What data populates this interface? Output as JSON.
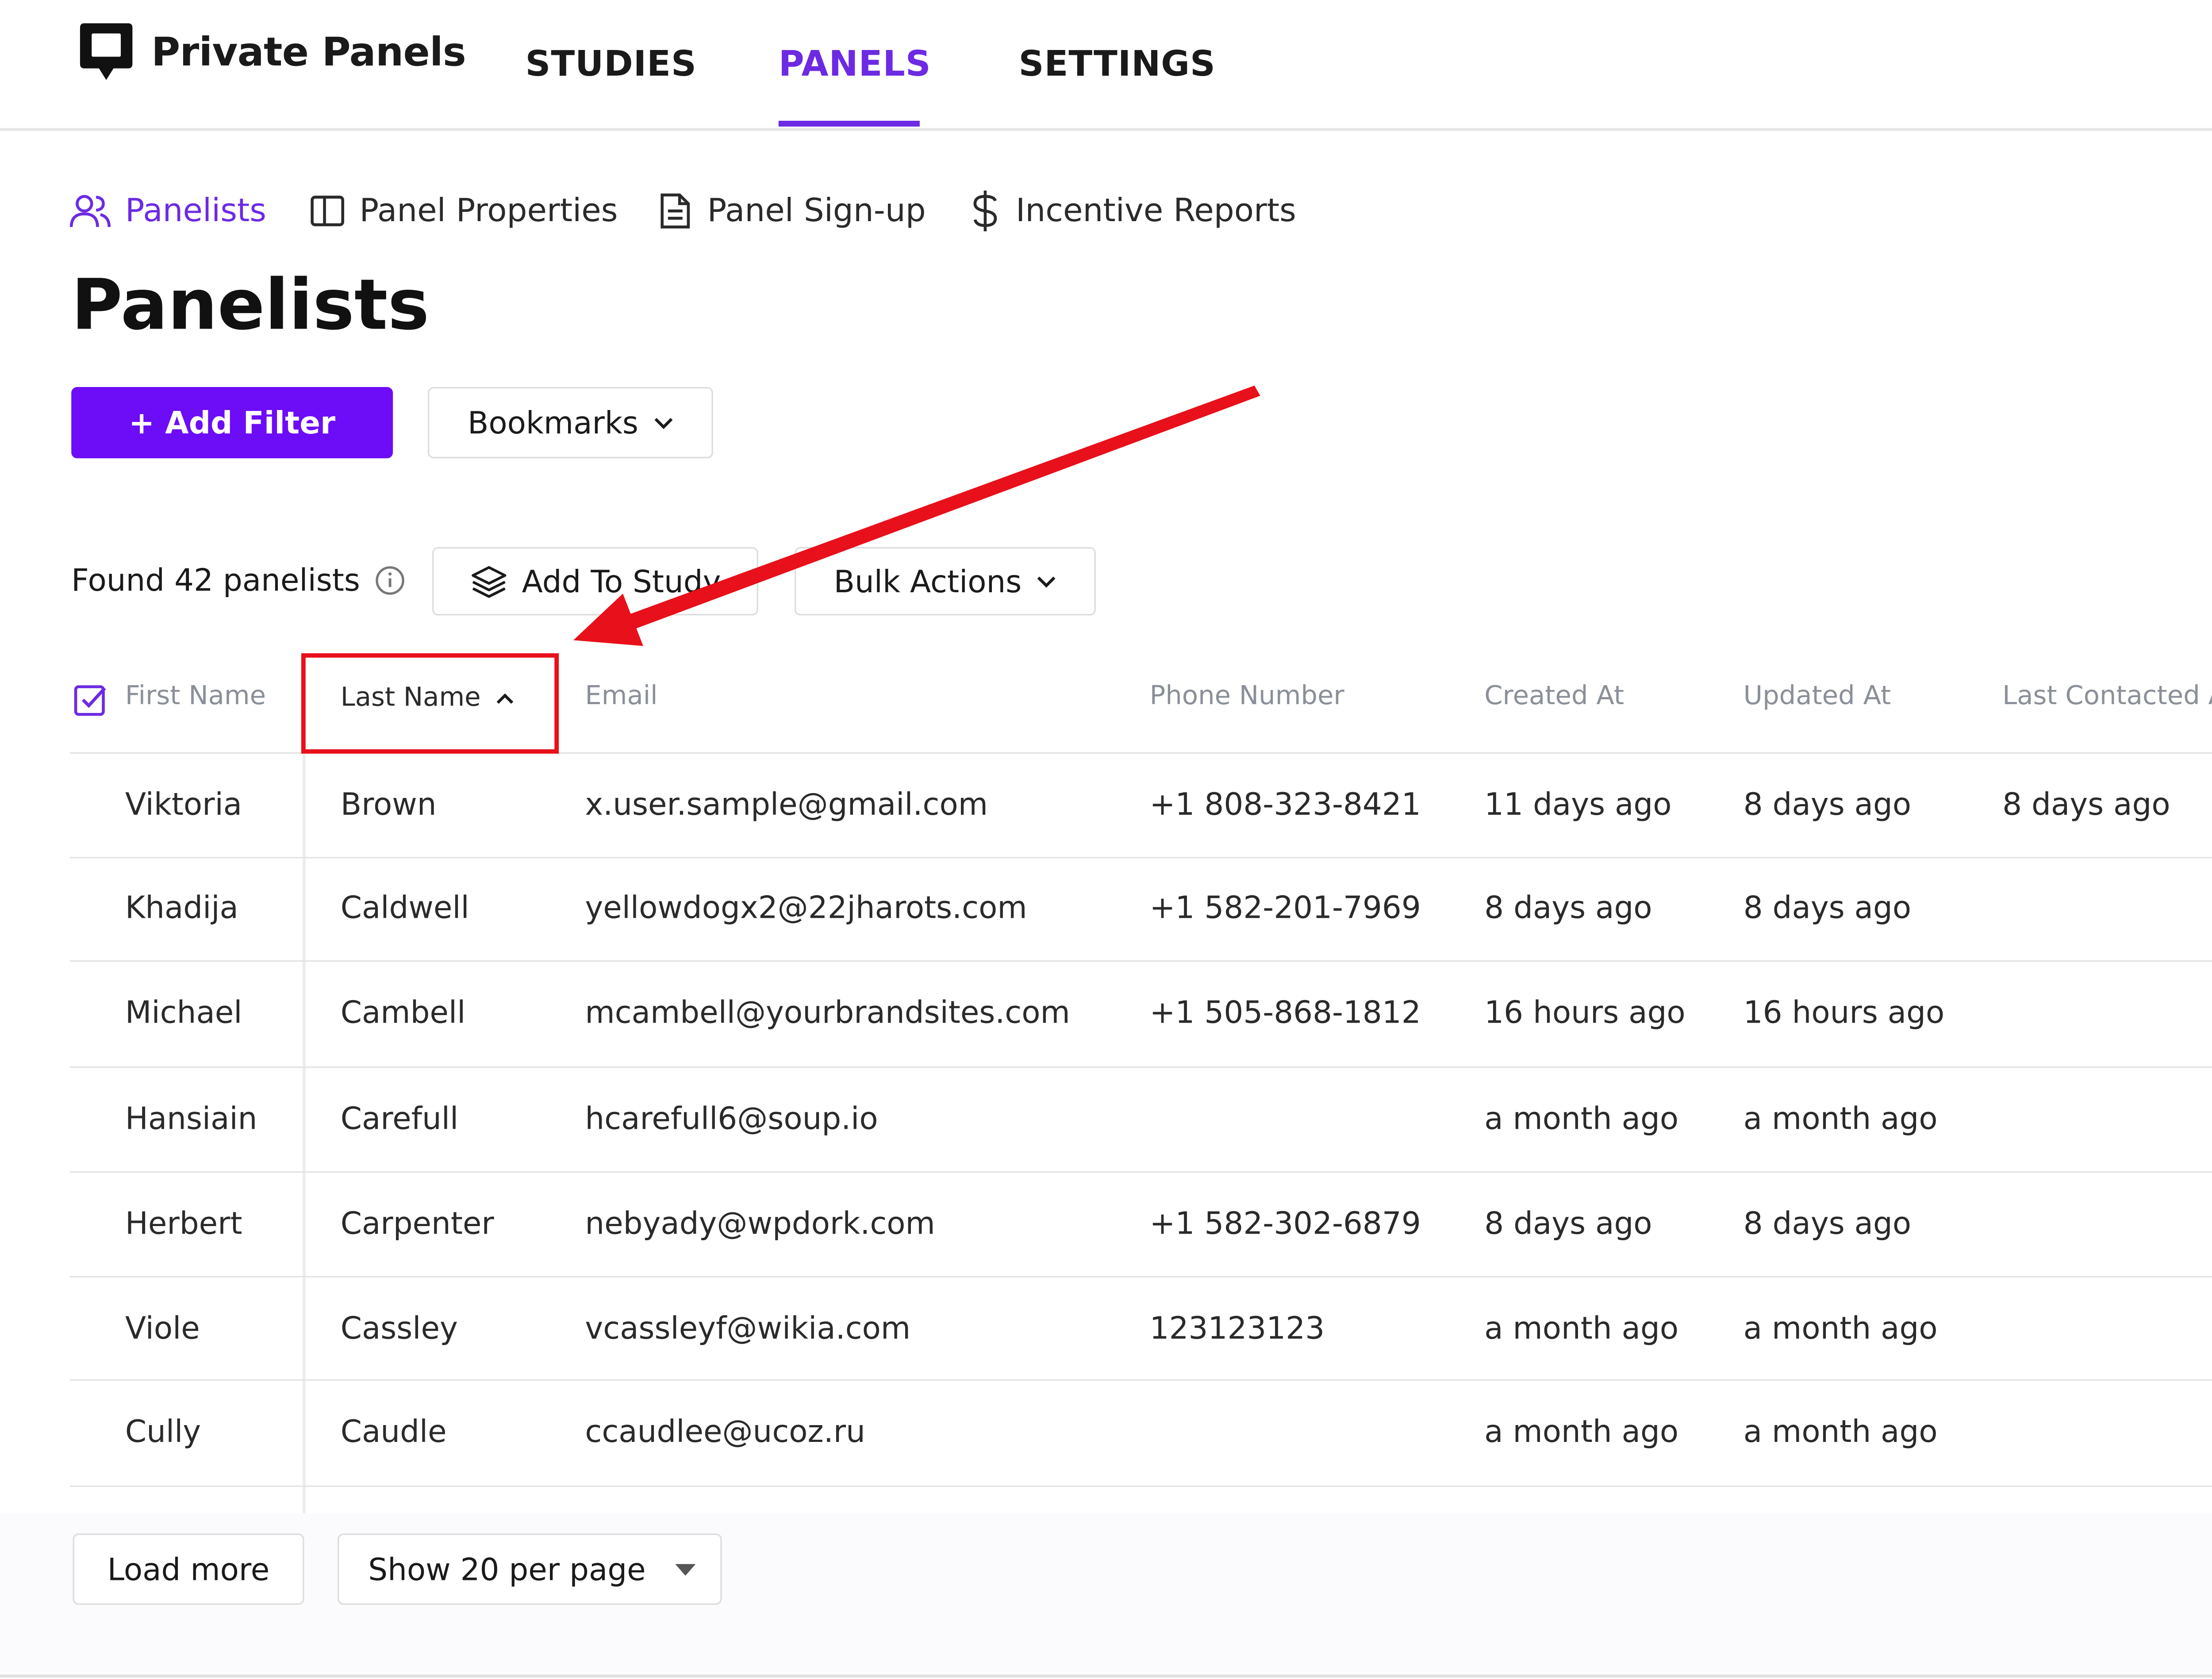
{
  "brand": {
    "name": "Private Panels"
  },
  "nav": {
    "tabs": [
      {
        "label": "STUDIES"
      },
      {
        "label": "PANELS"
      },
      {
        "label": "SETTINGS"
      }
    ],
    "active": "PANELS"
  },
  "subnav": {
    "items": [
      {
        "label": "Panelists",
        "icon": "users-icon"
      },
      {
        "label": "Panel Properties",
        "icon": "columns-icon"
      },
      {
        "label": "Panel Sign-up",
        "icon": "document-icon"
      },
      {
        "label": "Incentive Reports",
        "icon": "dollar-icon"
      }
    ]
  },
  "page": {
    "title": "Panelists"
  },
  "toolbar": {
    "add_filter": "+ Add Filter",
    "bookmarks": "Bookmarks"
  },
  "results": {
    "found": "Found 42 panelists",
    "add_to_study": "Add To Study",
    "bulk_actions": "Bulk Actions"
  },
  "table": {
    "headers": [
      "First Name",
      "Last Name",
      "Email",
      "Phone Number",
      "Created At",
      "Updated At",
      "Last Contacted At"
    ],
    "sort": {
      "column": "Last Name",
      "direction": "ascending"
    },
    "rows": [
      [
        "Viktoria",
        "Brown",
        "x.user.sample@gmail.com",
        "+1 808-323-8421",
        "11 days ago",
        "8 days ago",
        "8 days ago"
      ],
      [
        "Khadija",
        "Caldwell",
        "yellowdogx2@22jharots.com",
        "+1 582-201-7969",
        "8 days ago",
        "8 days ago",
        ""
      ],
      [
        "Michael",
        "Cambell",
        "mcambell@yourbrandsites.com",
        "+1 505-868-1812",
        "16 hours ago",
        "16 hours ago",
        ""
      ],
      [
        "Hansiain",
        "Carefull",
        "hcarefull6@soup.io",
        "",
        "a month ago",
        "a month ago",
        ""
      ],
      [
        "Herbert",
        "Carpenter",
        "nebyady@wpdork.com",
        "+1 582-302-6879",
        "8 days ago",
        "8 days ago",
        ""
      ],
      [
        "Viole",
        "Cassley",
        "vcassleyf@wikia.com",
        "123123123",
        "a month ago",
        "a month ago",
        ""
      ],
      [
        "Cully",
        "Caudle",
        "ccaudlee@ucoz.ru",
        "",
        "a month ago",
        "a month ago",
        ""
      ]
    ]
  },
  "pagination": {
    "load_more": "Load more",
    "per_page": "Show 20 per page"
  },
  "colors": {
    "accent": "#6d2ae3",
    "primary_button": "#6d0cf7",
    "annotation": "#e8101a"
  }
}
